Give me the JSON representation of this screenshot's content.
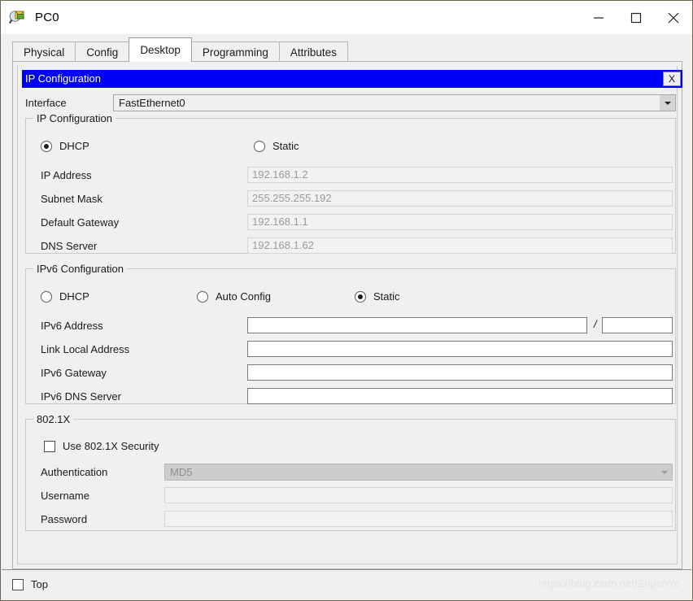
{
  "window": {
    "title": "PC0",
    "icon": "packet-tracer-logo-icon",
    "controls": {
      "minimize": "minimize-icon",
      "maximize": "maximize-icon",
      "close": "close-icon"
    }
  },
  "tabs": [
    {
      "label": "Physical",
      "active": false
    },
    {
      "label": "Config",
      "active": false
    },
    {
      "label": "Desktop",
      "active": true
    },
    {
      "label": "Programming",
      "active": false
    },
    {
      "label": "Attributes",
      "active": false
    }
  ],
  "subwindow": {
    "title": "IP Configuration",
    "close_label": "X"
  },
  "interface": {
    "label": "Interface",
    "value": "FastEthernet0"
  },
  "ipv4": {
    "group_title": "IP Configuration",
    "modes": [
      {
        "label": "DHCP",
        "selected": true
      },
      {
        "label": "Static",
        "selected": false
      }
    ],
    "fields": [
      {
        "label": "IP Address",
        "value": "192.168.1.2",
        "disabled": true
      },
      {
        "label": "Subnet Mask",
        "value": "255.255.255.192",
        "disabled": true
      },
      {
        "label": "Default Gateway",
        "value": "192.168.1.1",
        "disabled": true
      },
      {
        "label": "DNS Server",
        "value": "192.168.1.62",
        "disabled": true
      }
    ]
  },
  "ipv6": {
    "group_title": "IPv6 Configuration",
    "modes": [
      {
        "label": "DHCP",
        "selected": false
      },
      {
        "label": "Auto Config",
        "selected": false
      },
      {
        "label": "Static",
        "selected": true
      }
    ],
    "fields": [
      {
        "label": "IPv6 Address",
        "value": "",
        "disabled": false
      },
      {
        "label": "Link Local Address",
        "value": "",
        "disabled": false
      },
      {
        "label": "IPv6 Gateway",
        "value": "",
        "disabled": false
      },
      {
        "label": "IPv6 DNS Server",
        "value": "",
        "disabled": false
      }
    ],
    "prefix_separator": "/",
    "prefix_value": ""
  },
  "dot1x": {
    "group_title": "802.1X",
    "checkbox_label": "Use 802.1X Security",
    "checkbox_checked": false,
    "authentication": {
      "label": "Authentication",
      "value": "MD5",
      "disabled": true
    },
    "fields": [
      {
        "label": "Username",
        "value": "",
        "disabled": true
      },
      {
        "label": "Password",
        "value": "",
        "disabled": true
      }
    ]
  },
  "footer": {
    "top_label": "Top",
    "top_checked": false,
    "watermark": "https://blog.csdn.net/ZripenYe"
  },
  "colors": {
    "subtitle_bar": "#0000f4",
    "panel_bg": "#f0f0f0",
    "field_disabled_text": "#9a9a9a"
  }
}
